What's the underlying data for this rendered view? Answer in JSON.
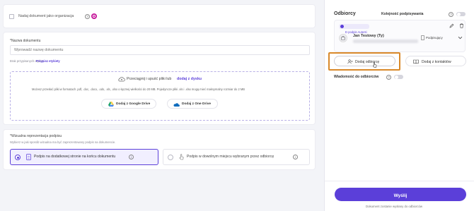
{
  "top": {
    "org_checkbox_label": "Nadaj dokument jako organizacja"
  },
  "doc_name": {
    "label": "*Nazwa dokumentu",
    "placeholder": "Wprowadź nazwę dokumentu",
    "no_labels_text": "Brak przypisanych etykiet.",
    "assign_labels_link": "Przypisz etykiety"
  },
  "upload": {
    "drag_text": "Przeciągnij i upuść pliki lub",
    "drag_link": "dodaj z dysku",
    "info": "Możesz przesłać pliki w formatach .pdf, .doc, .docx, .ods, .xls, .xlsx o łącznej wielkości do 20 MB. Pojedyncze pliki .xls i .xlsx mogą mieć maksymalny rozmiar do 2 MB",
    "gdrive_label": "Dodaj z Google Drive",
    "onedrive_label": "Dodaj z One Drive"
  },
  "visual": {
    "title": "*Wizualna reprezentacja podpisu",
    "subtitle": "Wybierz w jaki sposób wizualna ma być zaprezentowany podpis na dokumencie.",
    "option1": "Podpis na dodatkowej stronie na końcu dokumentu",
    "option2": "Podpis w dowolnym miejscu wybranym przez odbiorcę"
  },
  "recipients": {
    "title": "Odbiorcy",
    "order_label": "Kolejność podpisywania",
    "signature_badge": "E-podpis Autenti",
    "recipient_name": "Jan Testowy (Ty)",
    "role_label": "Podpisujący",
    "add_recipient": "Dodaj odbiorcę",
    "add_from_contacts": "Dodaj z kontaktów",
    "message_label": "Wiadomość do odbiorców"
  },
  "footer": {
    "send_button": "Wyślij",
    "note": "Dokument zostanie wysłany do odbiorców"
  },
  "colors": {
    "accent": "#5b3fd9",
    "highlight": "#d9892a",
    "google_drive": [
      "#1fa463",
      "#ffd04b",
      "#4687f4"
    ],
    "one_drive": "#0f6cbd"
  }
}
